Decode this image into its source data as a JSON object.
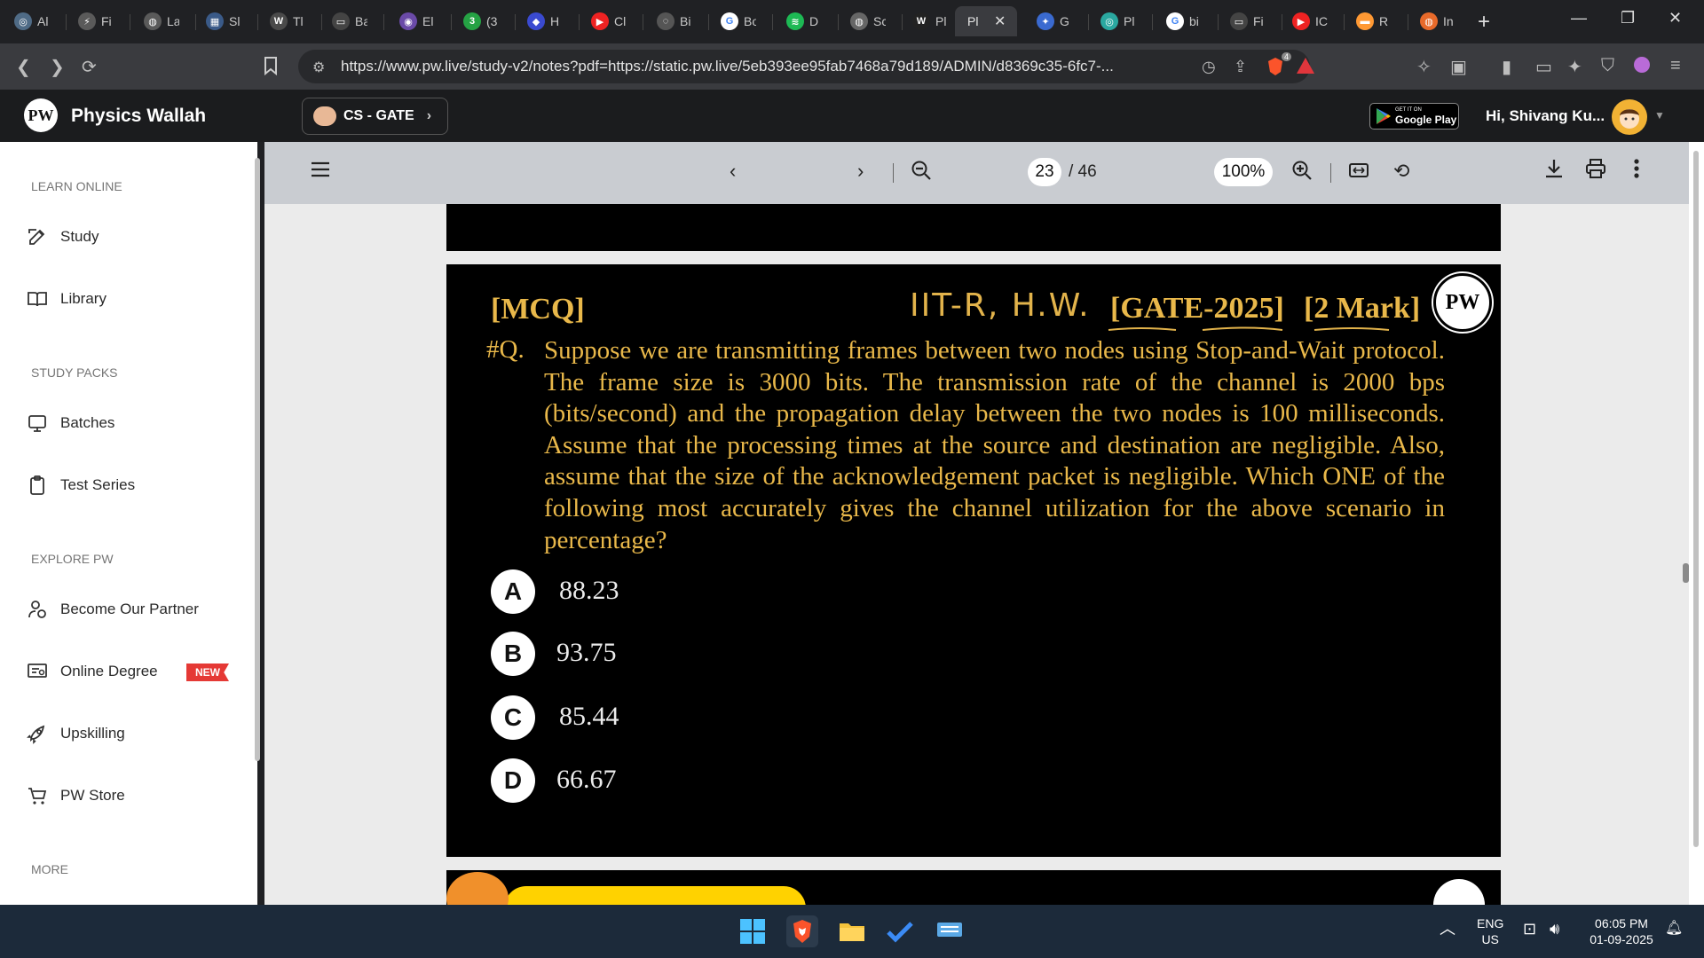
{
  "browser": {
    "tabs": [
      {
        "label": "Al",
        "color": "#4f6b86",
        "glyph": "◎"
      },
      {
        "label": "Fi",
        "color": "#5a5a5a",
        "glyph": "⚡"
      },
      {
        "label": "La",
        "color": "#5a5a5a",
        "glyph": "◍"
      },
      {
        "label": "Sl",
        "color": "#3a5a88",
        "glyph": "▦"
      },
      {
        "label": "Tl",
        "color": "#4a4a4a",
        "glyph": "W"
      },
      {
        "label": "Ba",
        "color": "#444",
        "glyph": "▭"
      },
      {
        "label": "El",
        "color": "#6a4aa8",
        "glyph": "◉"
      },
      {
        "label": "(3",
        "color": "#25a244",
        "glyph": "3"
      },
      {
        "label": "H",
        "color": "#3a4ad0",
        "glyph": "◆"
      },
      {
        "label": "Cl",
        "color": "#e22",
        "glyph": "▶"
      },
      {
        "label": "Bi",
        "color": "#555",
        "glyph": "◌"
      },
      {
        "label": "Bo",
        "color": "#ffffff",
        "glyph": "G"
      },
      {
        "label": "D",
        "color": "#1db954",
        "glyph": "≋"
      },
      {
        "label": "Sc",
        "color": "#666",
        "glyph": "◍"
      },
      {
        "label": "Pl",
        "color": "#222",
        "glyph": "W"
      },
      {
        "label": "Pl",
        "color": "#3a3b3f",
        "glyph": ""
      },
      {
        "label": "G",
        "color": "#3a6ad0",
        "glyph": "✦"
      },
      {
        "label": "Pl",
        "color": "#2aa8a0",
        "glyph": "◎"
      },
      {
        "label": "bi",
        "color": "#ffffff",
        "glyph": "G"
      },
      {
        "label": "Fi",
        "color": "#444",
        "glyph": "▭"
      },
      {
        "label": "IC",
        "color": "#e22",
        "glyph": "▶"
      },
      {
        "label": "R",
        "color": "#ff9933",
        "glyph": "▬"
      },
      {
        "label": "In",
        "color": "#e86a2a",
        "glyph": "◍"
      }
    ],
    "url": "https://www.pw.live/study-v2/notes?pdf=https://static.pw.live/5eb393ee95fab7468a79d189/ADMIN/d8369c35-6fc7-...",
    "brave_badge": "4"
  },
  "header": {
    "brand": "Physics Wallah",
    "logo_text": "PW",
    "batch": "CS - GATE",
    "gplay_small": "GET IT ON",
    "gplay_big": "Google Play",
    "greeting": "Hi, Shivang Ku..."
  },
  "sidebar": {
    "sections": [
      {
        "title": "LEARN ONLINE",
        "items": [
          "Study",
          "Library"
        ]
      },
      {
        "title": "STUDY PACKS",
        "items": [
          "Batches",
          "Test Series"
        ]
      },
      {
        "title": "EXPLORE PW",
        "items": [
          "Become Our Partner",
          "Online Degree",
          "Upskilling",
          "PW Store"
        ]
      },
      {
        "title": "MORE",
        "items": []
      }
    ],
    "new_badge": "NEW"
  },
  "viewer": {
    "page": "23",
    "total": "/ 46",
    "zoom": "100%"
  },
  "slide": {
    "mcq": "[MCQ]",
    "handwritten": "IIT-R, H.W.",
    "tag_gate": "[GATE-2025]",
    "tag_marks": "[2 Mark]",
    "logo_text": "PW",
    "q_label": "#Q.",
    "question": "Suppose we are transmitting frames between two nodes using Stop-and-Wait protocol. The frame size is 3000 bits. The transmission rate of the channel is 2000 bps (bits/second) and the propagation delay between the two nodes is 100 milliseconds. Assume that the processing times at the source and destination are negligible. Also, assume that the size of the acknowledgement packet is negligible. Which ONE of the following most accurately gives the channel utilization for the above scenario in percentage?",
    "options": [
      {
        "letter": "A",
        "value": "88.23"
      },
      {
        "letter": "B",
        "value": "93.75"
      },
      {
        "letter": "C",
        "value": "85.44"
      },
      {
        "letter": "D",
        "value": "66.67"
      }
    ]
  },
  "taskbar": {
    "lang_line1": "ENG",
    "lang_line2": "US",
    "time": "06:05 PM",
    "date": "01-09-2025"
  }
}
